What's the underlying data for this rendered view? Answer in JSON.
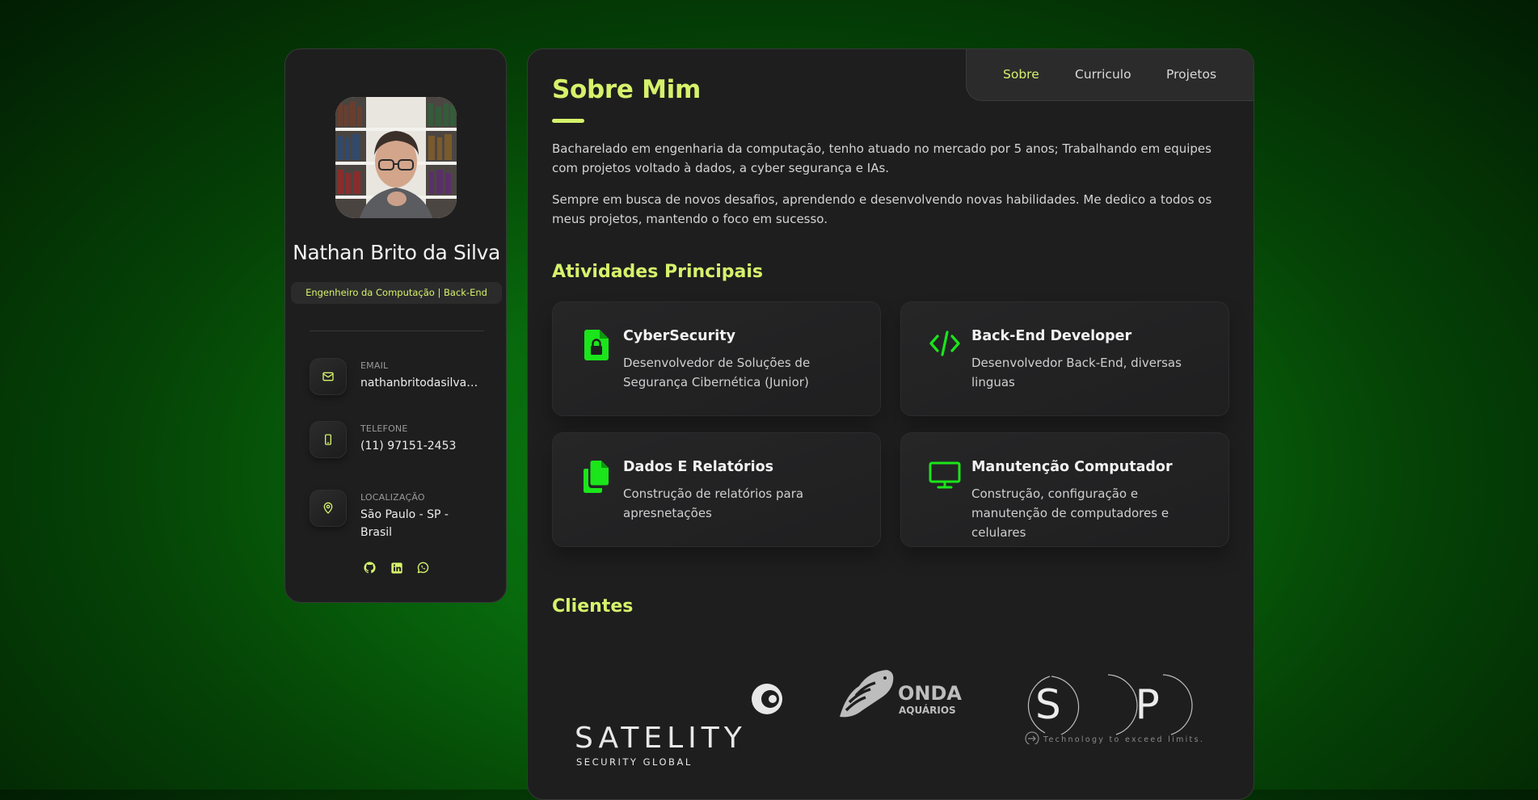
{
  "profile": {
    "name": "Nathan Brito da Silva",
    "role": "Engenheiro da Computação | Back-End",
    "avatar_icon": "user-photo"
  },
  "contacts": [
    {
      "label": "EMAIL",
      "value": "nathanbritodasilvag...",
      "icon": "mail-icon"
    },
    {
      "label": "TELEFONE",
      "value": "(11) 97151-2453",
      "icon": "phone-icon"
    },
    {
      "label": "LOCALIZAÇÃO",
      "value": "São Paulo - SP - Brasil",
      "icon": "map-pin-icon"
    }
  ],
  "socials": [
    "github-icon",
    "linkedin-icon",
    "whatsapp-icon"
  ],
  "nav": {
    "items": [
      {
        "label": "Sobre",
        "active": true
      },
      {
        "label": "Curriculo",
        "active": false
      },
      {
        "label": "Projetos",
        "active": false
      }
    ]
  },
  "about": {
    "title": "Sobre Mim",
    "paragraphs": [
      "Bacharelado em engenharia da computação, tenho atuado no mercado por 5 anos; Trabalhando em equipes com projetos voltado à dados, a cyber segurança e IAs.",
      "Sempre em busca de novos desafios, aprendendo e desenvolvendo novas habilidades. Me dedico a todos os meus projetos, mantendo o foco em sucesso."
    ]
  },
  "services": {
    "title": "Atividades Principais",
    "items": [
      {
        "title": "CyberSecurity",
        "description": "Desenvolvedor de Soluções de Segurança Cibernética (Junior)",
        "icon": "file-lock-icon"
      },
      {
        "title": "Back-End Developer",
        "description": "Desenvolvedor Back-End, diversas linguas",
        "icon": "code-icon"
      },
      {
        "title": "Dados E Relatórios",
        "description": "Construção de relatórios para apresnetações",
        "icon": "files-icon"
      },
      {
        "title": "Manutenção Computador",
        "description": "Construção, configuração e manutenção de computadores e celulares",
        "icon": "monitor-icon"
      }
    ]
  },
  "clients": {
    "title": "Clientes",
    "logos": [
      {
        "name": "SATELITY",
        "tagline": "SECURITY GLOBAL"
      },
      {
        "name": "ONDA",
        "tagline": "AQUÁRIOS"
      },
      {
        "name": "S P I",
        "tagline": "Technology to exceed limits."
      }
    ]
  },
  "colors": {
    "accent": "#d6f26b",
    "icon_green": "#1be51b",
    "panel": "#1e1e1f"
  }
}
